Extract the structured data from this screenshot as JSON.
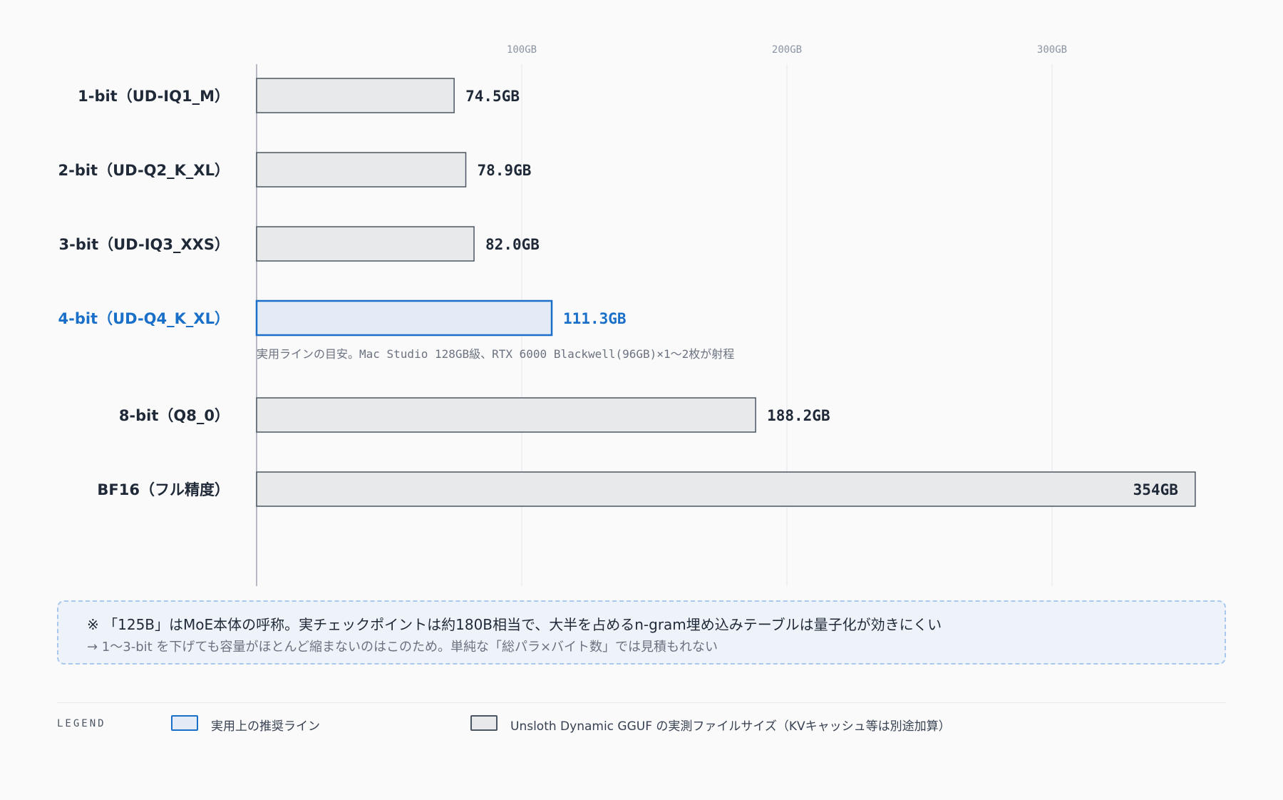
{
  "chart_data": {
    "type": "bar",
    "orientation": "horizontal",
    "categories": [
      "1-bit（UD-IQ1_M）",
      "2-bit（UD-Q2_K_XL）",
      "3-bit（UD-IQ3_XXS）",
      "4-bit（UD-Q4_K_XL）",
      "8-bit（Q8_0）",
      "BF16（フル精度）"
    ],
    "values": [
      74.5,
      78.9,
      82.0,
      111.3,
      188.2,
      354
    ],
    "value_labels": [
      "74.5GB",
      "78.9GB",
      "82.0GB",
      "111.3GB",
      "188.2GB",
      "354GB"
    ],
    "highlight_index": 3,
    "highlight_note": "実用ラインの目安。Mac Studio 128GB級、RTX 6000 Blackwell(96GB)×1〜2枚が射程",
    "x_ticks": [
      100,
      200,
      300
    ],
    "x_tick_labels": [
      "100GB",
      "200GB",
      "300GB"
    ],
    "xlim": [
      0,
      354
    ],
    "grid": true,
    "legend_position": "bottom-left",
    "colors": {
      "bar_fill": "#e8e9eb",
      "bar_stroke": "#4b5563",
      "highlight_fill": "#e2ebf6",
      "highlight_stroke": "#1a6fc9",
      "text": "#1f2937",
      "highlight_text": "#1a6fc9",
      "grid": "#e5e7eb",
      "axis": "#9ca3af"
    }
  },
  "callout": {
    "line1": "※ 「125B」はMoE本体の呼称。実チェックポイントは約180B相当で、大半を占めるn-gram埋め込みテーブルは量子化が効きにくい",
    "line2": "→ 1〜3-bit を下げても容量がほとんど縮まないのはこのため。単純な「総パラ×バイト数」では見積もれない"
  },
  "legend": {
    "title": "LEGEND",
    "items": [
      {
        "label": "実用上の推奨ライン"
      },
      {
        "label": "Unsloth Dynamic GGUF の実測ファイルサイズ（KVキャッシュ等は別途加算）"
      }
    ]
  }
}
